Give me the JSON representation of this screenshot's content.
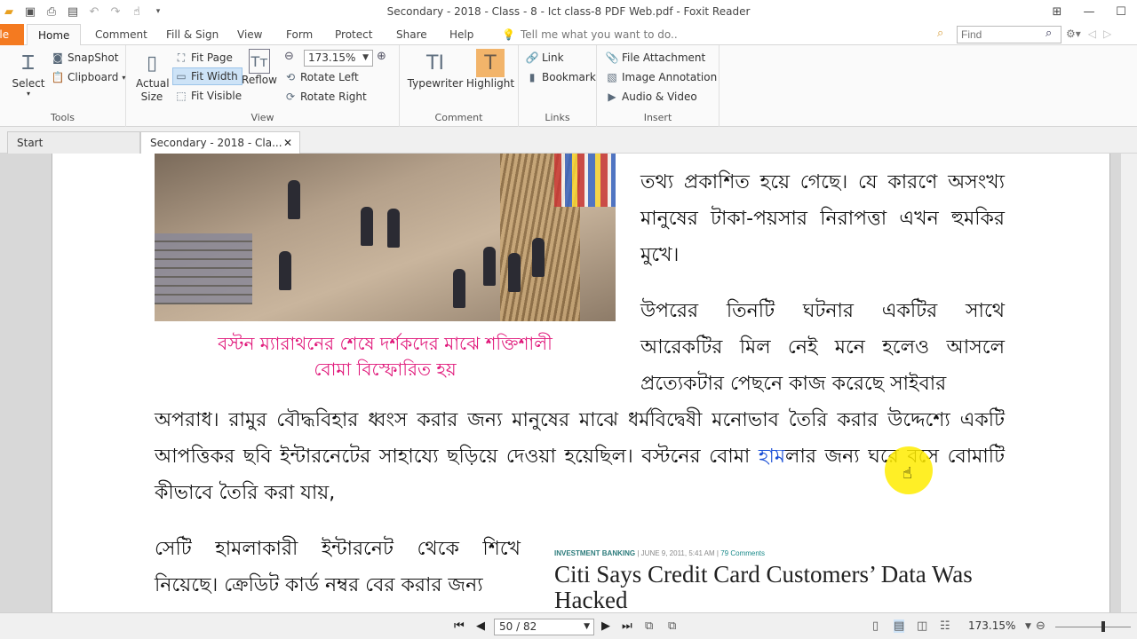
{
  "window": {
    "title": "Secondary - 2018 - Class - 8 - Ict class-8 PDF Web.pdf - Foxit Reader"
  },
  "menu": {
    "file": "File",
    "tabs": [
      "Home",
      "Comment",
      "Fill & Sign",
      "View",
      "Form",
      "Protect",
      "Share",
      "Help"
    ],
    "tell_me": "Tell me what you want to do..",
    "find_placeholder": "Find"
  },
  "ribbon": {
    "tools": {
      "select": "Select",
      "snapshot": "SnapShot",
      "clipboard": "Clipboard",
      "label": "Tools"
    },
    "view": {
      "actual_size": "Actual Size",
      "fit_page": "Fit Page",
      "fit_width": "Fit Width",
      "fit_visible": "Fit Visible",
      "reflow": "Reflow",
      "zoom": "173.15%",
      "rotate_left": "Rotate Left",
      "rotate_right": "Rotate Right",
      "label": "View"
    },
    "comment": {
      "typewriter": "Typewriter",
      "highlight": "Highlight",
      "label": "Comment"
    },
    "links": {
      "link": "Link",
      "bookmark": "Bookmark",
      "label": "Links"
    },
    "insert": {
      "file_attachment": "File Attachment",
      "image_annotation": "Image Annotation",
      "audio_video": "Audio & Video",
      "label": "Insert"
    }
  },
  "doc_tabs": {
    "start": "Start",
    "current": "Secondary - 2018 - Cla..."
  },
  "document": {
    "right_col_1": "তথ্য প্রকাশিত হয়ে গেছে। যে কারণে অসংখ্য মানুষের টাকা-পয়সার নিরাপত্তা এখন হুমকির মুখে।",
    "right_col_2": "উপরের তিনটি ঘটনার একটির সাথে আরেকটির মিল নেই মনে হলেও আসলে প্রত্যেকটার পেছনে কাজ করেছে সাইবার",
    "full_width_a": "অপরাধ। রামুর বৌদ্ধবিহার ধ্বংস করার জন্য মানুষের মাঝে ধর্মবিদ্বেষী মনোভাব তৈরি করার উদ্দেশ্যে একটি আপত্তিকর ছবি ইন্টারনেটের সাহায্যে ছড়িয়ে দেওয়া হয়েছিল। বস্টনের বোমা ",
    "full_width_highlight": "হাম",
    "full_width_b": "লার জন্য ঘরে বসে বোমাটি কীভাবে তৈরি করা যায়,",
    "left_col": "সেটি হামলাকারী ইন্টারনেট থেকে শিখে নিয়েছে। ক্রেডিট কার্ড নম্বর বের করার জন্য",
    "caption_line1": "বস্টন ম্যারাথনের শেষে দর্শকদের মাঝে শক্তিশালী",
    "caption_line2": "বোমা বিস্ফোরিত হয়",
    "news_category": "INVESTMENT BANKING",
    "news_date": "JUNE 9, 2011, 5:41 AM",
    "news_comments": "79 Comments",
    "news_title": "Citi Says Credit Card Customers’ Data Was Hacked"
  },
  "status": {
    "page": "50 / 82",
    "zoom": "173.15%"
  },
  "colors": {
    "file_tab": "#f47a20",
    "caption": "#e0187a",
    "highlight": "#ffd700"
  }
}
